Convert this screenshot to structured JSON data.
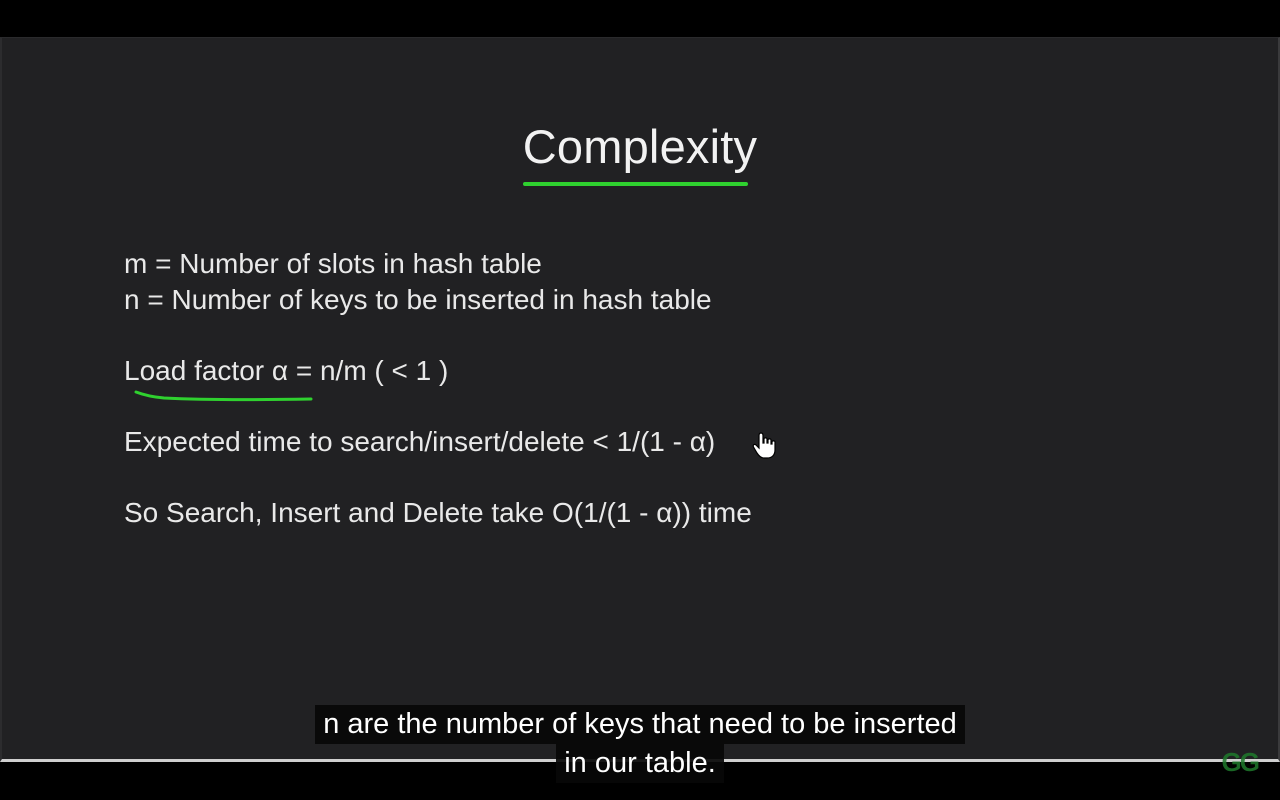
{
  "slide": {
    "title": "Complexity",
    "lines": [
      "m = Number of slots in hash table",
      "n = Number of keys to be inserted in hash table",
      "Load factor α = n/m  ( < 1 )",
      "Expected time to search/insert/delete < 1/(1 - α)",
      "So Search, Insert and Delete take O(1/(1 - α)) time"
    ],
    "watermark": "GG"
  },
  "captions": {
    "line1": "n are the number of keys that need to be inserted",
    "line2": "in our table."
  },
  "colors": {
    "accent": "#2fd12f",
    "slide_bg": "#212123",
    "text": "#e9e9e9"
  },
  "icons": {
    "cursor": "hand-pointer-icon"
  }
}
